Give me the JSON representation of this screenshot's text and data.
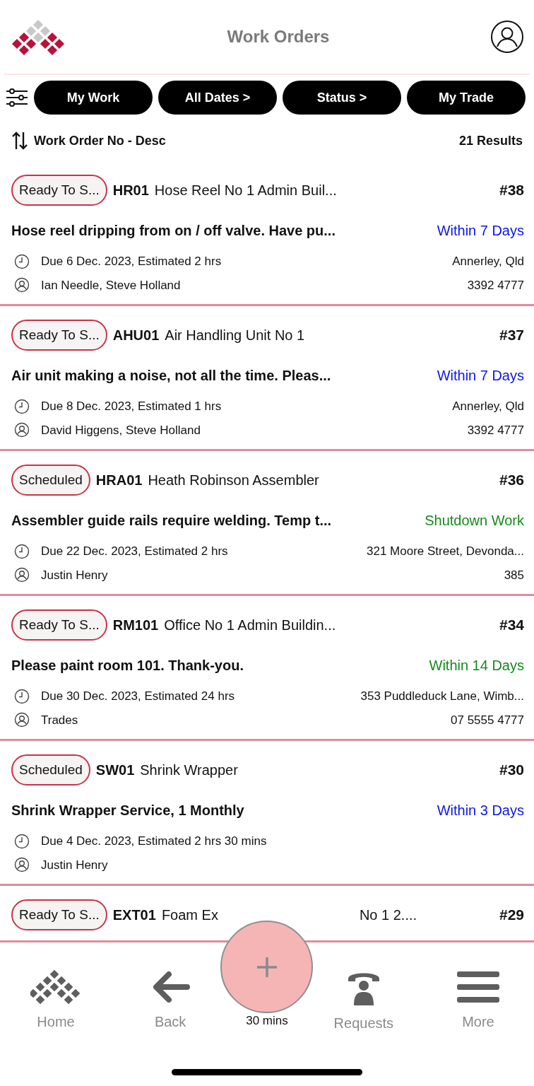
{
  "header": {
    "title": "Work Orders"
  },
  "filters": [
    "My Work",
    "All Dates >",
    "Status >",
    "My Trade"
  ],
  "sort": {
    "label": "Work Order No - Desc",
    "results": "21 Results"
  },
  "work_orders": [
    {
      "status": "Ready To S...",
      "code": "HR01",
      "asset": [
        "Hose Reel No 1 Admin Buil..."
      ],
      "number": "#38",
      "summary": "Hose reel dripping from on / off valve.  Have pu...",
      "priority": "Within 7 Days",
      "color": "#0a14f0",
      "due": "Due 6 Dec. 2023, Estimated 2 hrs",
      "location": "Annerley, Qld",
      "people": "Ian Needle, Steve Holland",
      "phone": "3392 4777"
    },
    {
      "status": "Ready To S...",
      "code": "AHU01",
      "asset": [
        "Air Handling Unit No 1"
      ],
      "number": "#37",
      "summary": "Air unit making a noise, not all the time.  Pleas...",
      "priority": "Within 7 Days",
      "color": "#0a14f0",
      "due": "Due 8 Dec. 2023, Estimated 1 hrs",
      "location": "Annerley, Qld",
      "people": "David Higgens, Steve Holland",
      "phone": "3392 4777"
    },
    {
      "status": "Scheduled",
      "code": "HRA01",
      "asset": [
        "Heath Robinson Assembler"
      ],
      "number": "#36",
      "summary": "Assembler guide rails require welding.  Temp t...",
      "priority": "Shutdown Work",
      "color": "#16891b",
      "due": "Due 22 Dec. 2023, Estimated 2 hrs",
      "location": "321 Moore Street, Devonda...",
      "people": "Justin Henry",
      "phone": "385"
    },
    {
      "status": "Ready To S...",
      "code": "RM101",
      "asset": [
        "Office No 1 Admin Buildin..."
      ],
      "number": "#34",
      "summary": "Please paint room 101.  Thank-you.",
      "priority": "Within 14 Days",
      "color": "#16891b",
      "due": "Due 30 Dec. 2023, Estimated 24 hrs",
      "location": "353 Puddleduck Lane, Wimb...",
      "people": "Trades",
      "phone": "07 5555 4777"
    },
    {
      "status": "Scheduled",
      "code": "SW01",
      "asset": [
        "Shrink Wrapper"
      ],
      "number": "#30",
      "summary": "Shrink Wrapper Service, 1 Monthly",
      "priority": "Within 3 Days",
      "color": "#0a14f0",
      "due": "Due 4 Dec. 2023, Estimated 2 hrs 30 mins",
      "people": "Justin Henry"
    },
    {
      "status": "Ready To S...",
      "code": "EXT01",
      "asset": [
        "Foam Ex",
        "No 1 2...."
      ],
      "number": "#29"
    }
  ],
  "bottom_nav": {
    "items": [
      "Home",
      "Back",
      "Requests",
      "More"
    ],
    "fragment": "30 mins"
  }
}
